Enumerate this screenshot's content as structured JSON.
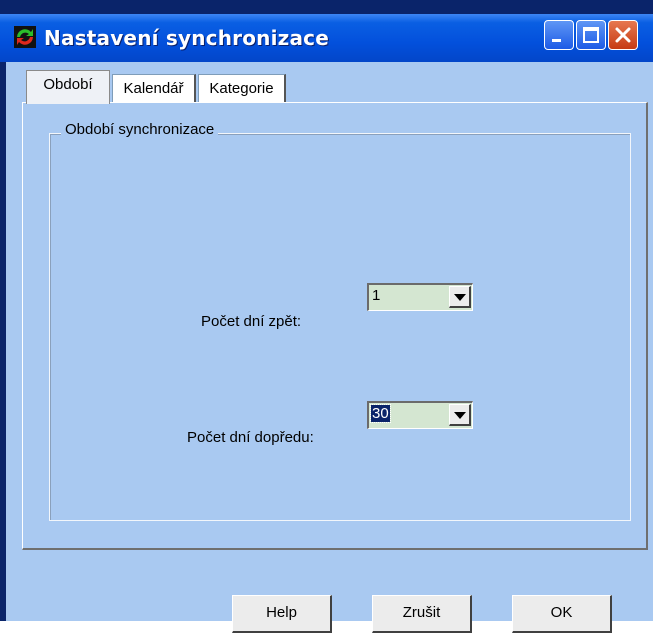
{
  "window": {
    "title": "Nastavení synchronizace"
  },
  "tabs": [
    {
      "label": "Období",
      "active": true
    },
    {
      "label": "Kalendář",
      "active": false
    },
    {
      "label": "Kategorie",
      "active": false
    }
  ],
  "group": {
    "legend": "Období synchronizace"
  },
  "fields": {
    "days_back": {
      "label": "Počet dní zpět:",
      "value": "1"
    },
    "days_forward": {
      "label": "Počet dní dopředu:",
      "value": "30"
    }
  },
  "buttons": {
    "help": "Help",
    "cancel": "Zrušit",
    "ok": "OK"
  },
  "colors": {
    "titlebar": "#0350dc",
    "client_bg": "#a9c9f1",
    "combo_bg": "#d4e6d1",
    "close_button": "#c63b14"
  }
}
